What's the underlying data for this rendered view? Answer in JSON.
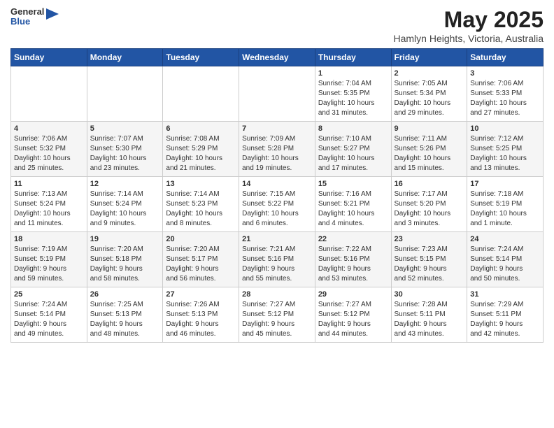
{
  "header": {
    "logo_general": "General",
    "logo_blue": "Blue",
    "month_title": "May 2025",
    "location": "Hamlyn Heights, Victoria, Australia"
  },
  "weekdays": [
    "Sunday",
    "Monday",
    "Tuesday",
    "Wednesday",
    "Thursday",
    "Friday",
    "Saturday"
  ],
  "weeks": [
    [
      {
        "day": "",
        "info": ""
      },
      {
        "day": "",
        "info": ""
      },
      {
        "day": "",
        "info": ""
      },
      {
        "day": "",
        "info": ""
      },
      {
        "day": "1",
        "info": "Sunrise: 7:04 AM\nSunset: 5:35 PM\nDaylight: 10 hours\nand 31 minutes."
      },
      {
        "day": "2",
        "info": "Sunrise: 7:05 AM\nSunset: 5:34 PM\nDaylight: 10 hours\nand 29 minutes."
      },
      {
        "day": "3",
        "info": "Sunrise: 7:06 AM\nSunset: 5:33 PM\nDaylight: 10 hours\nand 27 minutes."
      }
    ],
    [
      {
        "day": "4",
        "info": "Sunrise: 7:06 AM\nSunset: 5:32 PM\nDaylight: 10 hours\nand 25 minutes."
      },
      {
        "day": "5",
        "info": "Sunrise: 7:07 AM\nSunset: 5:30 PM\nDaylight: 10 hours\nand 23 minutes."
      },
      {
        "day": "6",
        "info": "Sunrise: 7:08 AM\nSunset: 5:29 PM\nDaylight: 10 hours\nand 21 minutes."
      },
      {
        "day": "7",
        "info": "Sunrise: 7:09 AM\nSunset: 5:28 PM\nDaylight: 10 hours\nand 19 minutes."
      },
      {
        "day": "8",
        "info": "Sunrise: 7:10 AM\nSunset: 5:27 PM\nDaylight: 10 hours\nand 17 minutes."
      },
      {
        "day": "9",
        "info": "Sunrise: 7:11 AM\nSunset: 5:26 PM\nDaylight: 10 hours\nand 15 minutes."
      },
      {
        "day": "10",
        "info": "Sunrise: 7:12 AM\nSunset: 5:25 PM\nDaylight: 10 hours\nand 13 minutes."
      }
    ],
    [
      {
        "day": "11",
        "info": "Sunrise: 7:13 AM\nSunset: 5:24 PM\nDaylight: 10 hours\nand 11 minutes."
      },
      {
        "day": "12",
        "info": "Sunrise: 7:14 AM\nSunset: 5:24 PM\nDaylight: 10 hours\nand 9 minutes."
      },
      {
        "day": "13",
        "info": "Sunrise: 7:14 AM\nSunset: 5:23 PM\nDaylight: 10 hours\nand 8 minutes."
      },
      {
        "day": "14",
        "info": "Sunrise: 7:15 AM\nSunset: 5:22 PM\nDaylight: 10 hours\nand 6 minutes."
      },
      {
        "day": "15",
        "info": "Sunrise: 7:16 AM\nSunset: 5:21 PM\nDaylight: 10 hours\nand 4 minutes."
      },
      {
        "day": "16",
        "info": "Sunrise: 7:17 AM\nSunset: 5:20 PM\nDaylight: 10 hours\nand 3 minutes."
      },
      {
        "day": "17",
        "info": "Sunrise: 7:18 AM\nSunset: 5:19 PM\nDaylight: 10 hours\nand 1 minute."
      }
    ],
    [
      {
        "day": "18",
        "info": "Sunrise: 7:19 AM\nSunset: 5:19 PM\nDaylight: 9 hours\nand 59 minutes."
      },
      {
        "day": "19",
        "info": "Sunrise: 7:20 AM\nSunset: 5:18 PM\nDaylight: 9 hours\nand 58 minutes."
      },
      {
        "day": "20",
        "info": "Sunrise: 7:20 AM\nSunset: 5:17 PM\nDaylight: 9 hours\nand 56 minutes."
      },
      {
        "day": "21",
        "info": "Sunrise: 7:21 AM\nSunset: 5:16 PM\nDaylight: 9 hours\nand 55 minutes."
      },
      {
        "day": "22",
        "info": "Sunrise: 7:22 AM\nSunset: 5:16 PM\nDaylight: 9 hours\nand 53 minutes."
      },
      {
        "day": "23",
        "info": "Sunrise: 7:23 AM\nSunset: 5:15 PM\nDaylight: 9 hours\nand 52 minutes."
      },
      {
        "day": "24",
        "info": "Sunrise: 7:24 AM\nSunset: 5:14 PM\nDaylight: 9 hours\nand 50 minutes."
      }
    ],
    [
      {
        "day": "25",
        "info": "Sunrise: 7:24 AM\nSunset: 5:14 PM\nDaylight: 9 hours\nand 49 minutes."
      },
      {
        "day": "26",
        "info": "Sunrise: 7:25 AM\nSunset: 5:13 PM\nDaylight: 9 hours\nand 48 minutes."
      },
      {
        "day": "27",
        "info": "Sunrise: 7:26 AM\nSunset: 5:13 PM\nDaylight: 9 hours\nand 46 minutes."
      },
      {
        "day": "28",
        "info": "Sunrise: 7:27 AM\nSunset: 5:12 PM\nDaylight: 9 hours\nand 45 minutes."
      },
      {
        "day": "29",
        "info": "Sunrise: 7:27 AM\nSunset: 5:12 PM\nDaylight: 9 hours\nand 44 minutes."
      },
      {
        "day": "30",
        "info": "Sunrise: 7:28 AM\nSunset: 5:11 PM\nDaylight: 9 hours\nand 43 minutes."
      },
      {
        "day": "31",
        "info": "Sunrise: 7:29 AM\nSunset: 5:11 PM\nDaylight: 9 hours\nand 42 minutes."
      }
    ]
  ]
}
